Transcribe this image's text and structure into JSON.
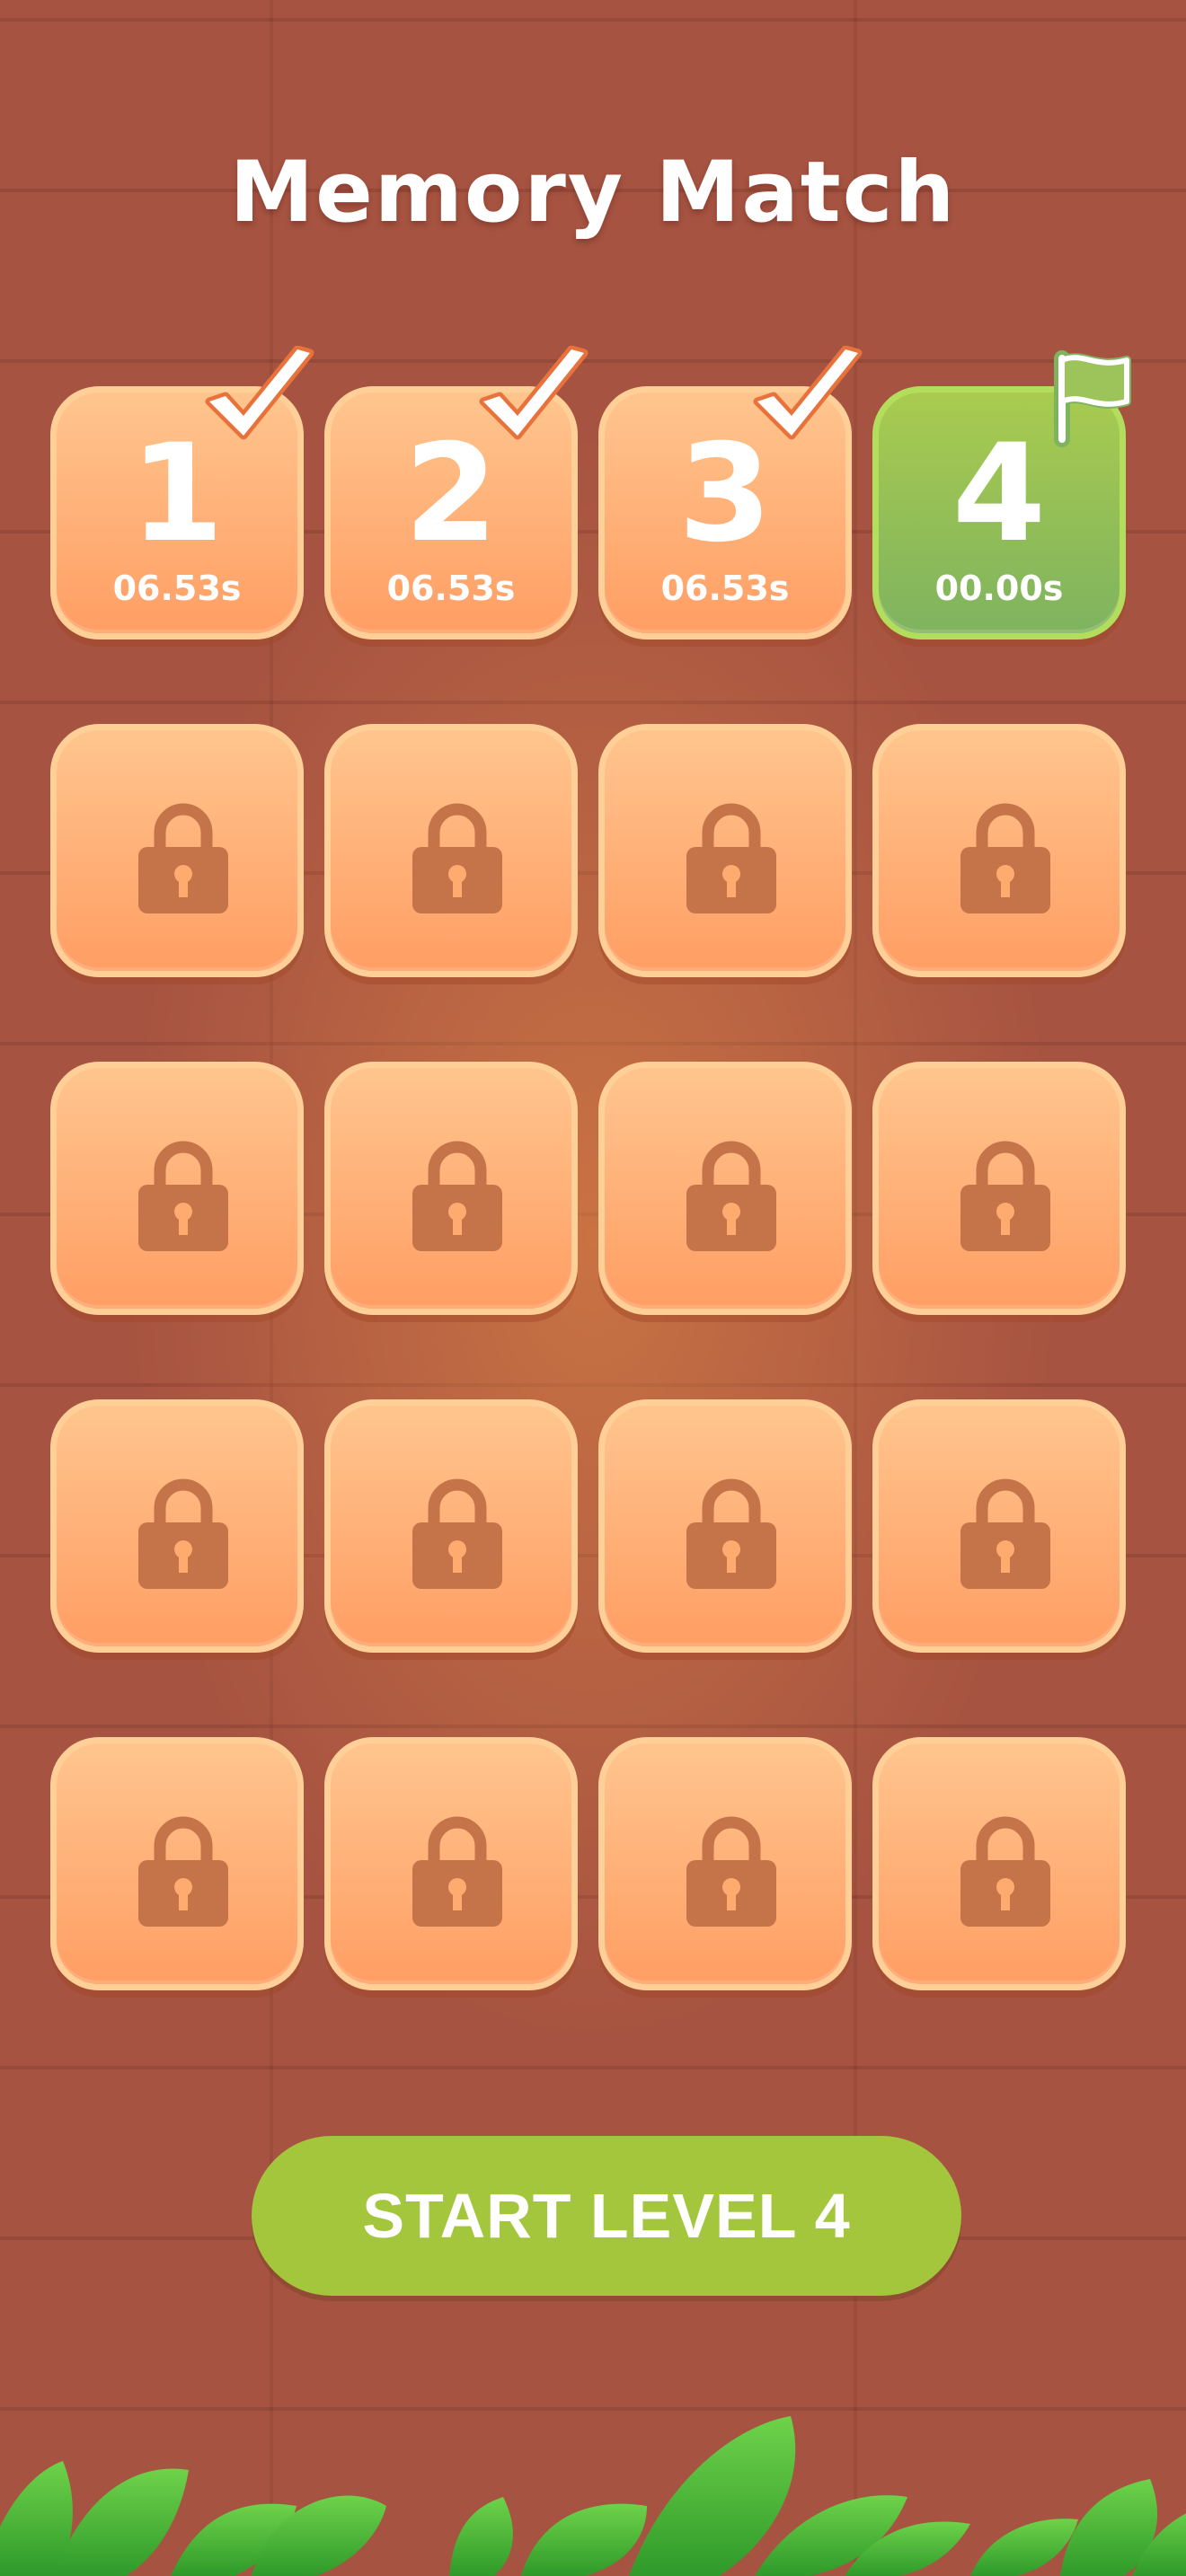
{
  "title": "Memory Match",
  "levels": [
    {
      "number": "1",
      "time": "06.53s",
      "status": "completed"
    },
    {
      "number": "2",
      "time": "06.53s",
      "status": "completed"
    },
    {
      "number": "3",
      "time": "06.53s",
      "status": "completed"
    },
    {
      "number": "4",
      "time": "00.00s",
      "status": "current"
    },
    {
      "status": "locked"
    },
    {
      "status": "locked"
    },
    {
      "status": "locked"
    },
    {
      "status": "locked"
    },
    {
      "status": "locked"
    },
    {
      "status": "locked"
    },
    {
      "status": "locked"
    },
    {
      "status": "locked"
    },
    {
      "status": "locked"
    },
    {
      "status": "locked"
    },
    {
      "status": "locked"
    },
    {
      "status": "locked"
    },
    {
      "status": "locked"
    },
    {
      "status": "locked"
    },
    {
      "status": "locked"
    },
    {
      "status": "locked"
    }
  ],
  "icons": {
    "completed": "checkmark-icon",
    "current": "flag-icon",
    "locked": "lock-icon"
  },
  "start_button": {
    "label": "START LEVEL 4"
  },
  "colors": {
    "background": "#a65341",
    "tile_orange": "#ffb07a",
    "tile_green": "#94c05a",
    "button_green": "#a4c63d",
    "lock_brown": "#c5744a"
  }
}
